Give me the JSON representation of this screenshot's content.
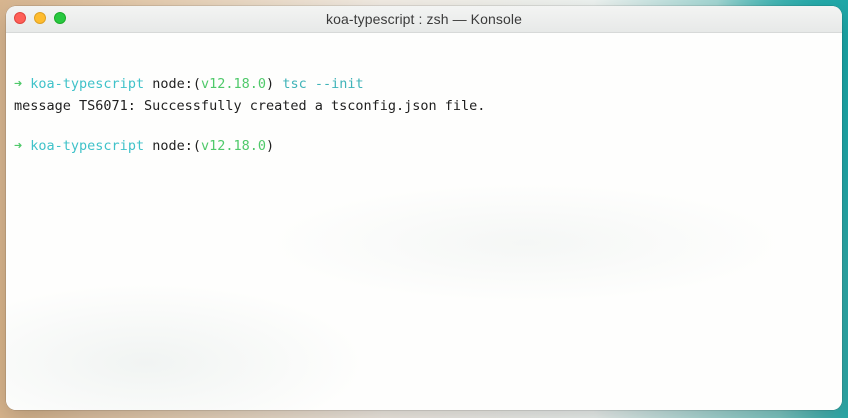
{
  "window": {
    "title": "koa-typescript : zsh — Konsole"
  },
  "traffic_lights": {
    "close_color": "#fe5f57",
    "minimize_color": "#febc2e",
    "maximize_color": "#28c840"
  },
  "terminal": {
    "lines": [
      {
        "arrow": "➜",
        "dir": "koa-typescript",
        "node_label": "node:(",
        "version": "v12.18.0",
        "node_close": ")",
        "command": "tsc --init"
      },
      {
        "output": "message TS6071: Successfully created a tsconfig.json file."
      },
      {
        "arrow": "➜",
        "dir": "koa-typescript",
        "node_label": "node:(",
        "version": "v12.18.0",
        "node_close": ")"
      }
    ]
  },
  "colors": {
    "prompt_arrow": "#4fc96a",
    "prompt_dir": "#3fc2c9",
    "version": "#4fc96a",
    "command": "#3fb3b8",
    "text": "#1f1f1f"
  }
}
